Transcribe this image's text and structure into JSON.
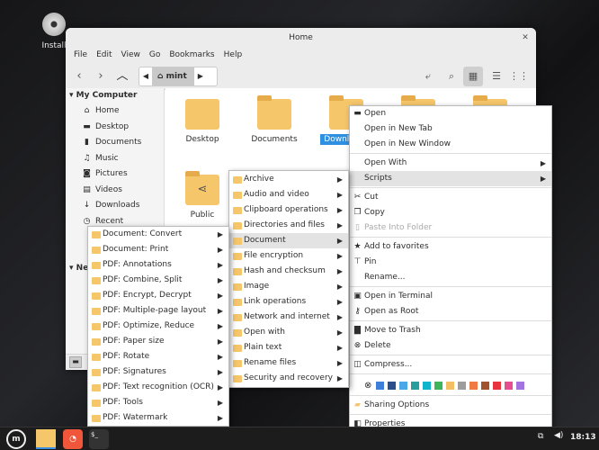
{
  "desktop": {
    "install_label": "Install"
  },
  "window": {
    "title": "Home",
    "close": "✕",
    "menu": [
      "File",
      "Edit",
      "View",
      "Go",
      "Bookmarks",
      "Help"
    ],
    "breadcrumb": "mint",
    "sidebar": {
      "my_computer": "My Computer",
      "items": [
        "Home",
        "Desktop",
        "Documents",
        "Music",
        "Pictures",
        "Videos",
        "Downloads",
        "Recent"
      ],
      "network": "Network"
    },
    "files": [
      "Desktop",
      "Documents",
      "Downloads",
      "Public"
    ]
  },
  "context_menu": {
    "items": [
      "Open",
      "Open in New Tab",
      "Open in New Window",
      "Open With",
      "Scripts",
      "Cut",
      "Copy",
      "Paste Into Folder",
      "Add to favorites",
      "Pin",
      "Rename...",
      "Open in Terminal",
      "Open as Root",
      "Move to Trash",
      "Delete",
      "Compress...",
      "Sharing Options",
      "Properties"
    ],
    "colors": [
      "#3d7fd9",
      "#2b4f8a",
      "#4aa7e8",
      "#2a9d9d",
      "#10b5cc",
      "#3eb55a",
      "#f4be62",
      "#9d9d9d",
      "#f07a43",
      "#a0522d",
      "#e8343e",
      "#e54f8f",
      "#a374e0"
    ]
  },
  "scripts_menu": [
    "Archive",
    "Audio and video",
    "Clipboard operations",
    "Directories and files",
    "Document",
    "File encryption",
    "Hash and checksum",
    "Image",
    "Link operations",
    "Network and internet",
    "Open with",
    "Plain text",
    "Rename files",
    "Security and recovery"
  ],
  "document_menu": [
    "Document: Convert",
    "Document: Print",
    "PDF: Annotations",
    "PDF: Combine, Split",
    "PDF: Encrypt, Decrypt",
    "PDF: Multiple-page layout",
    "PDF: Optimize, Reduce",
    "PDF: Paper size",
    "PDF: Rotate",
    "PDF: Signatures",
    "PDF: Text recognition (OCR)",
    "PDF: Tools",
    "PDF: Watermark"
  ],
  "taskbar": {
    "time": "18:13"
  }
}
